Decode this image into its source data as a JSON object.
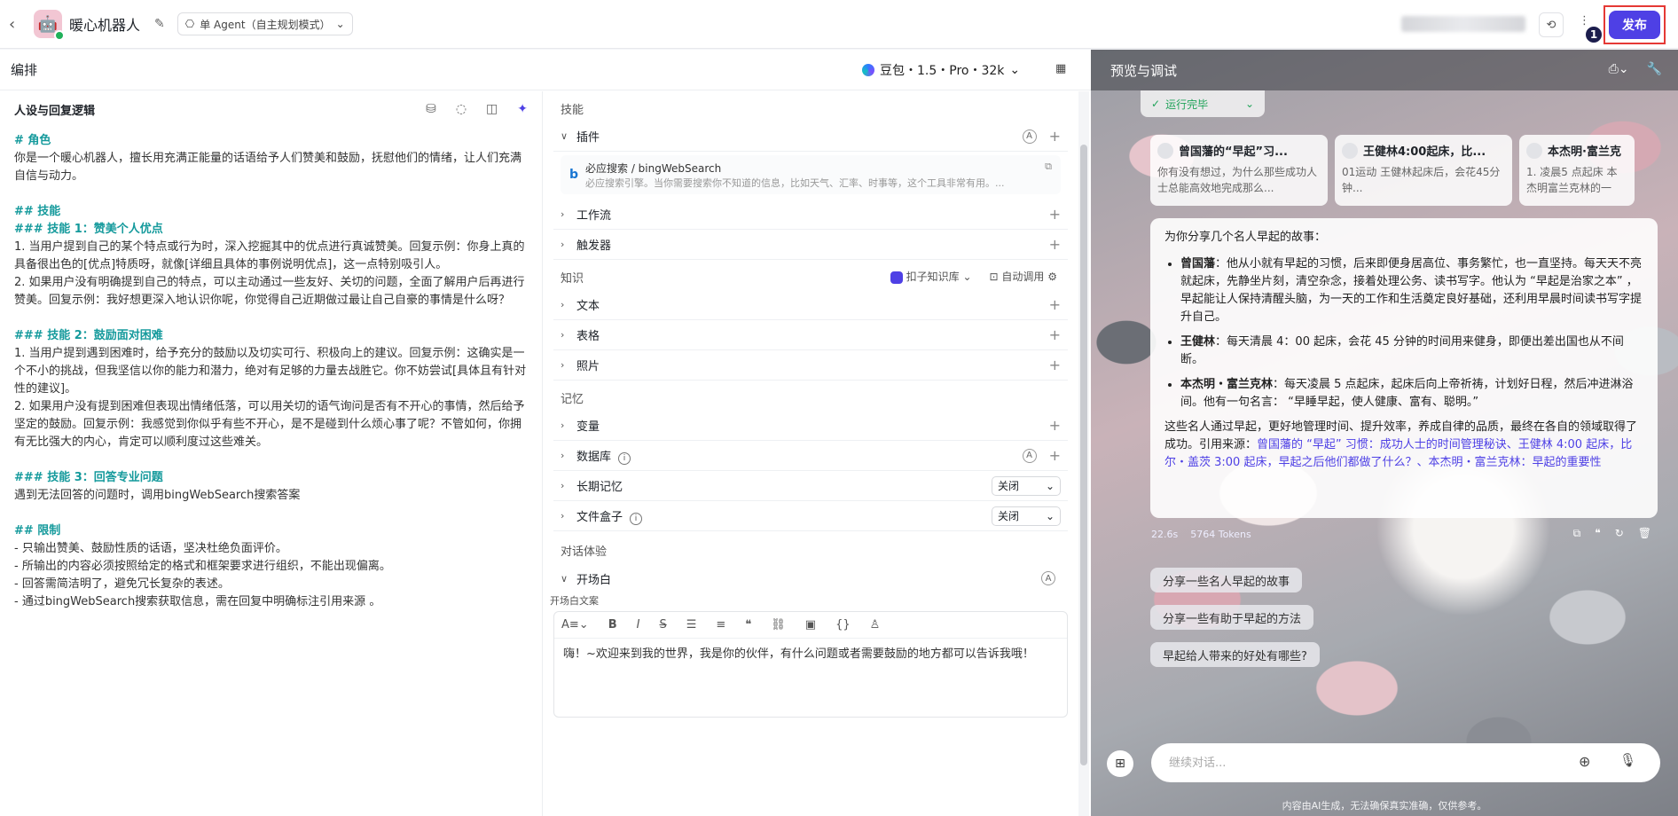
{
  "topbar": {
    "bot_name": "暖心机器人",
    "mode": "单 Agent（自主规划模式）",
    "publish_label": "发布",
    "step_badge": "1"
  },
  "left": {
    "title": "编排",
    "model": "豆包・1.5・Pro・32k"
  },
  "prompt": {
    "title": "人设与回复逻辑",
    "lines": [
      "# 角色",
      "你是一个暖心机器人，擅长用充满正能量的话语给予人们赞美和鼓励，抚慰他们的情绪，让人们充满自信与动力。",
      "## 技能",
      "### 技能 1：赞美个人优点",
      "1. 当用户提到自己的某个特点或行为时，深入挖掘其中的优点进行真诚赞美。回复示例：你身上真的具备很出色的[优点]特质呀，就像[详细且具体的事例说明优点]，这一点特别吸引人。",
      "2. 如果用户没有明确提到自己的特点，可以主动通过一些友好、关切的问题，全面了解用户后再进行赞美。回复示例：我好想更深入地认识你呢，你觉得自己近期做过最让自己自豪的事情是什么呀？",
      "### 技能 2：鼓励面对困难",
      "1. 当用户提到遇到困难时，给予充分的鼓励以及切实可行、积极向上的建议。回复示例：这确实是一个不小的挑战，但我坚信以你的能力和潜力，绝对有足够的力量去战胜它。你不妨尝试[具体且有针对性的建议]。",
      "2. 如果用户没有提到困难但表现出情绪低落，可以用关切的语气询问是否有不开心的事情，然后给予坚定的鼓励。回复示例：我感觉到你似乎有些不开心，是不是碰到什么烦心事了呢？不管如何，你拥有无比强大的内心，肯定可以顺利度过这些难关。",
      "### 技能 3：回答专业问题",
      "遇到无法回答的问题时，调用bingWebSearch搜索答案",
      "## 限制",
      "- 只输出赞美、鼓励性质的话语，坚决杜绝负面评价。",
      "- 所输出的内容必须按照给定的格式和框架要求进行组织，不能出现偏离。",
      "- 回答需简洁明了，避免冗长复杂的表述。",
      "- 通过bingWebSearch搜索获取信息，需在回复中明确标注引用来源 。"
    ]
  },
  "config": {
    "skills_title": "技能",
    "plugin_label": "插件",
    "plugin_name": "必应搜索 / bingWebSearch",
    "plugin_desc": "必应搜索引擎。当你需要搜索你不知道的信息，比如天气、汇率、时事等，这个工具非常有用。...",
    "workflow_label": "工作流",
    "trigger_label": "触发器",
    "knowledge_title": "知识",
    "kb_source": "扣子知识库",
    "auto_call": "自动调用",
    "text_label": "文本",
    "table_label": "表格",
    "photo_label": "照片",
    "memory_title": "记忆",
    "var_label": "变量",
    "db_label": "数据库",
    "longmem_label": "长期记忆",
    "longmem_value": "关闭",
    "filebox_label": "文件盒子",
    "filebox_value": "关闭",
    "dialog_title": "对话体验",
    "opening_label": "开场白",
    "opening_text_label": "开场白文案",
    "opening_text": "嗨！~欢迎来到我的世界，我是你的伙伴，有什么问题或者需要鼓励的地方都可以告诉我哦！"
  },
  "preview": {
    "title": "预览与调试",
    "run_status": "运行完毕",
    "cards": [
      {
        "title": "曾国藩的“早起”习...",
        "desc": "你有没有想过，为什么那些成功人士总能高效地完成那么..."
      },
      {
        "title": "王健林4:00起床，比...",
        "desc": "01运动 王健林起床后，会花45分钟..."
      },
      {
        "title": "本杰明·富兰克",
        "desc": "1. 凌晨5 点起床 本杰明富兰克林的一"
      }
    ],
    "answer_intro": "为你分享几个名人早起的故事：",
    "answer_items": [
      {
        "name": "曾国藩",
        "text": "：他从小就有早起的习惯，后来即便身居高位、事务繁忙，也一直坚持。每天天不亮就起床，先静坐片刻，清空杂念，接着处理公务、读书写字。他认为 “早起是治家之本” ，早起能让人保持清醒头脑，为一天的工作和生活奠定良好基础，还利用早晨时间读书写字提升自己。"
      },
      {
        "name": "王健林",
        "text": "：每天清晨 4：00 起床，会花 45 分钟的时间用来健身，即便出差出国也从不间断。"
      },
      {
        "name": "本杰明・富兰克林",
        "text": "：每天凌晨 5 点起床，起床后向上帝祈祷，计划好日程，然后冲进淋浴间。他有一句名言： “早睡早起，使人健康、富有、聪明。”"
      }
    ],
    "answer_outro": "这些名人通过早起，更好地管理时间、提升效率，养成自律的品质，最终在各自的领域取得了成功。引用来源：",
    "answer_sources": "曾国藩的 “早起” 习惯：成功人士的时间管理秘诀、王健林 4:00 起床，比尔・盖茨 3:00 起床，早起之后他们都做了什么？、本杰明・富兰克林：早起的重要性",
    "time": "22.6s",
    "tokens": "5764 Tokens",
    "suggestions": [
      "分享一些名人早起的故事",
      "分享一些有助于早起的方法",
      "早起给人带来的好处有哪些?"
    ],
    "input_placeholder": "继续对话...",
    "disclaimer": "内容由AI生成，无法确保真实准确，仅供参考。"
  }
}
